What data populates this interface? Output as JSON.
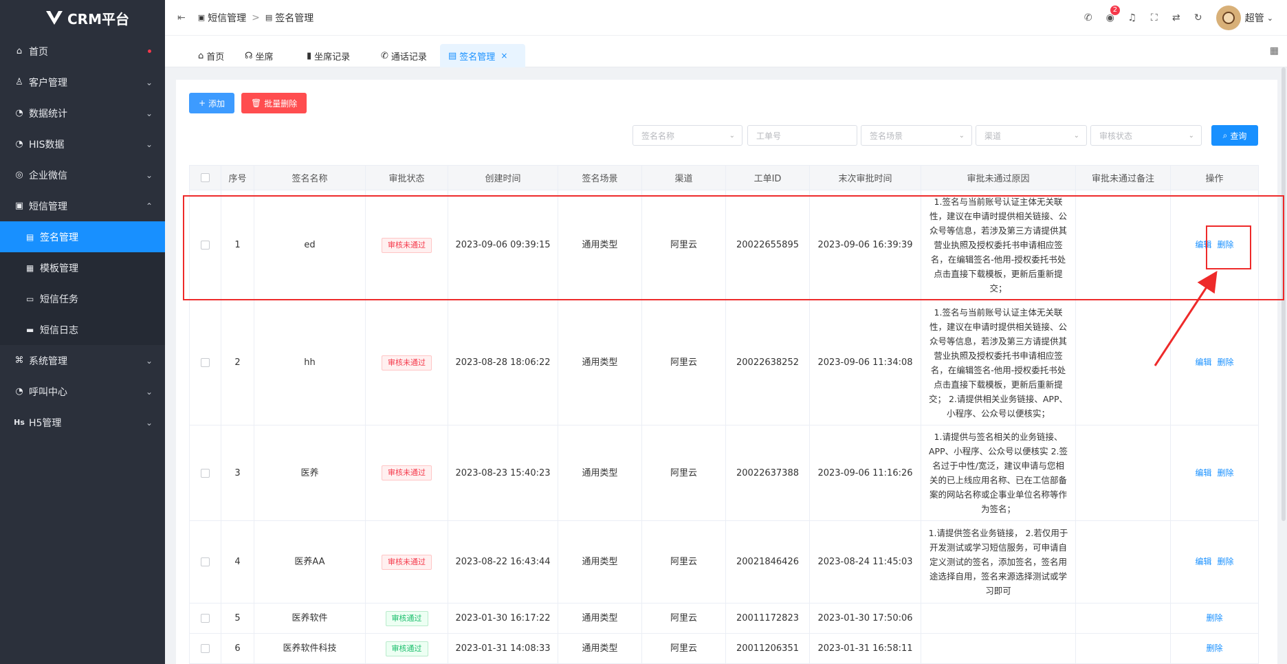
{
  "app": {
    "title": "CRM平台"
  },
  "sidebar": {
    "items": [
      {
        "label": "首页",
        "icon": "home-icon"
      },
      {
        "label": "客户管理",
        "icon": "user-icon"
      },
      {
        "label": "数据统计",
        "icon": "chart-icon"
      },
      {
        "label": "HIS数据",
        "icon": "data-icon"
      },
      {
        "label": "企业微信",
        "icon": "wechat-icon"
      },
      {
        "label": "短信管理",
        "icon": "message-icon"
      },
      {
        "label": "系统管理",
        "icon": "settings-icon"
      },
      {
        "label": "呼叫中心",
        "icon": "phone-icon"
      },
      {
        "label": "H5管理",
        "icon": "h5-icon"
      }
    ],
    "sms_sub": [
      {
        "label": "签名管理",
        "icon": "signature-icon"
      },
      {
        "label": "模板管理",
        "icon": "template-icon"
      },
      {
        "label": "短信任务",
        "icon": "task-icon"
      },
      {
        "label": "短信日志",
        "icon": "log-icon"
      }
    ]
  },
  "header": {
    "breadcrumb": [
      "短信管理",
      "签名管理"
    ],
    "notification_count": "2",
    "username": "超管"
  },
  "tabs": [
    {
      "label": "首页"
    },
    {
      "label": "坐席"
    },
    {
      "label": "坐席记录"
    },
    {
      "label": "通话记录"
    },
    {
      "label": "签名管理"
    }
  ],
  "toolbar": {
    "add_label": "添加",
    "batch_delete_label": "批量删除",
    "query_label": "查询"
  },
  "filters": {
    "sign_name": "签名名称",
    "ticket_no": "工单号",
    "scene": "签名场景",
    "channel": "渠道",
    "audit_status": "审核状态"
  },
  "table": {
    "headers": [
      "序号",
      "签名名称",
      "审批状态",
      "创建时间",
      "签名场景",
      "渠道",
      "工单ID",
      "末次审批时间",
      "审批未通过原因",
      "审批未通过备注",
      "操作"
    ],
    "rows": [
      {
        "no": "1",
        "name": "ed",
        "status": "审核未通过",
        "created": "2023-09-06 09:39:15",
        "scene": "通用类型",
        "channel": "阿里云",
        "ticket": "20022655895",
        "last": "2023-09-06 16:39:39",
        "reason": "1.签名与当前账号认证主体无关联性，建议在申请时提供相关链接、公众号等信息，若涉及第三方请提供其营业执照及授权委托书申请相应签名，在编辑签名-他用-授权委托书处点击直接下载模板，更新后重新提交；",
        "remark": "",
        "edit": "编辑",
        "delete": "删除"
      },
      {
        "no": "2",
        "name": "hh",
        "status": "审核未通过",
        "created": "2023-08-28 18:06:22",
        "scene": "通用类型",
        "channel": "阿里云",
        "ticket": "20022638252",
        "last": "2023-09-06 11:34:08",
        "reason": "1.签名与当前账号认证主体无关联性，建议在申请时提供相关链接、公众号等信息，若涉及第三方请提供其营业执照及授权委托书申请相应签名，在编辑签名-他用-授权委托书处点击直接下载模板，更新后重新提交； 2.请提供相关业务链接、APP、小程序、公众号以便核实；",
        "remark": "",
        "edit": "编辑",
        "delete": "删除"
      },
      {
        "no": "3",
        "name": "医养",
        "status": "审核未通过",
        "created": "2023-08-23 15:40:23",
        "scene": "通用类型",
        "channel": "阿里云",
        "ticket": "20022637388",
        "last": "2023-09-06 11:16:26",
        "reason": "1.请提供与签名相关的业务链接、APP、小程序、公众号以便核实 2.签名过于中性/宽泛，建议申请与您相关的已上线应用名称、已在工信部备案的网站名称或企事业单位名称等作为签名；",
        "remark": "",
        "edit": "编辑",
        "delete": "删除"
      },
      {
        "no": "4",
        "name": "医养AA",
        "status": "审核未通过",
        "created": "2023-08-22 16:43:44",
        "scene": "通用类型",
        "channel": "阿里云",
        "ticket": "20021846426",
        "last": "2023-08-24 11:45:03",
        "reason": "1.请提供签名业务链接， 2.若仅用于开发测试或学习短信服务，可申请自定义测试的签名，添加签名，签名用途选择自用，签名来源选择测试或学习即可",
        "remark": "",
        "edit": "编辑",
        "delete": "删除"
      },
      {
        "no": "5",
        "name": "医养软件",
        "status": "审核通过",
        "created": "2023-01-30 16:17:22",
        "scene": "通用类型",
        "channel": "阿里云",
        "ticket": "20011172823",
        "last": "2023-01-30 17:50:06",
        "reason": "",
        "remark": "",
        "edit": "",
        "delete": "删除"
      },
      {
        "no": "6",
        "name": "医养软件科技",
        "status": "审核通过",
        "created": "2023-01-31 14:08:33",
        "scene": "通用类型",
        "channel": "阿里云",
        "ticket": "20011206351",
        "last": "2023-01-31 16:58:11",
        "reason": "",
        "remark": "",
        "edit": "",
        "delete": "删除"
      }
    ]
  },
  "colors": {
    "sidebar_bg": "#2b303b",
    "accent": "#1890ff",
    "danger": "#ff4d4f",
    "annotation": "#ee2a2a"
  }
}
